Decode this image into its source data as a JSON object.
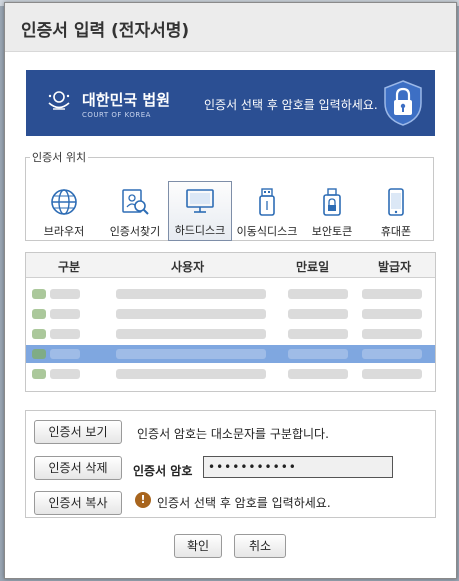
{
  "window": {
    "title": "인증서 입력 (전자서명)"
  },
  "banner": {
    "logo_kr": "대한민국 법원",
    "logo_en": "COURT OF KOREA",
    "message": "인증서 선택 후 암호를 입력하세요."
  },
  "location": {
    "legend": "인증서 위치",
    "items": [
      {
        "label": "브라우저",
        "icon": "globe-icon"
      },
      {
        "label": "인증서찾기",
        "icon": "certificate-search-icon"
      },
      {
        "label": "하드디스크",
        "icon": "monitor-icon",
        "selected": true
      },
      {
        "label": "이동식디스크",
        "icon": "usb-icon"
      },
      {
        "label": "보안토큰",
        "icon": "security-token-icon"
      },
      {
        "label": "휴대폰",
        "icon": "mobile-phone-icon"
      }
    ]
  },
  "table": {
    "columns": [
      "구분",
      "사용자",
      "만료일",
      "발급자"
    ],
    "selected_row": 3
  },
  "actions": {
    "view": "인증서 보기",
    "delete": "인증서 삭제",
    "copy": "인증서 복사"
  },
  "notice": {
    "case_sensitive": "인증서 암호는 대소문자를 구분합니다."
  },
  "password": {
    "label": "인증서 암호",
    "value": "•••••••••••"
  },
  "warning": {
    "text": "인증서 선택 후 암호를 입력하세요."
  },
  "footer": {
    "ok": "확인",
    "cancel": "취소"
  },
  "colors": {
    "banner": "#2b4f93",
    "selected_row": "#7fa7e0",
    "warning": "#a8651e"
  }
}
